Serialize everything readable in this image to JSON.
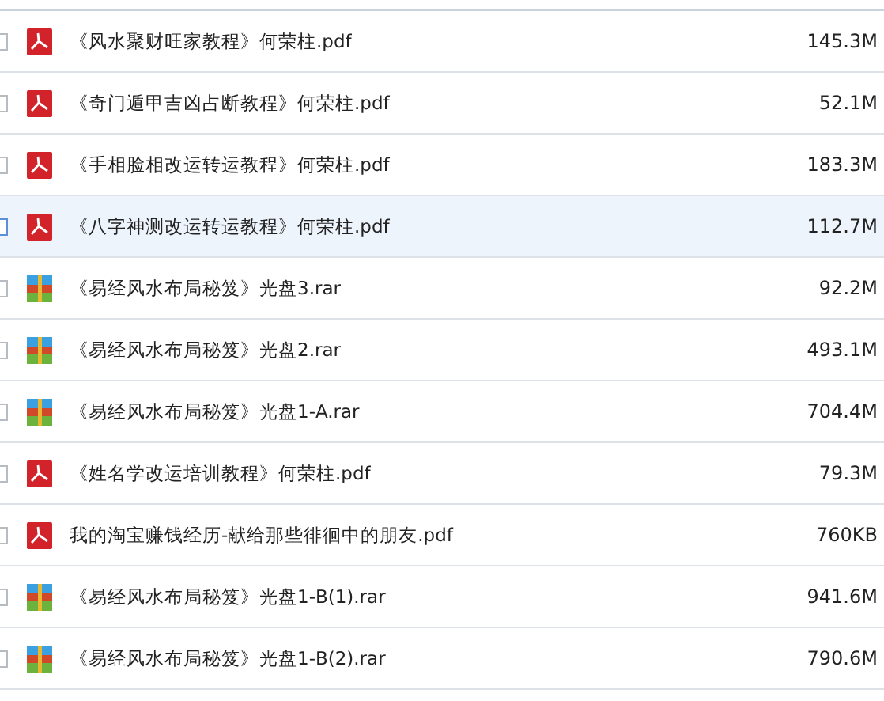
{
  "files": [
    {
      "kind": "pdf",
      "name": "《风水聚财旺家教程》何荣柱.pdf",
      "size": "145.3M",
      "highlighted": false
    },
    {
      "kind": "pdf",
      "name": "《奇门遁甲吉凶占断教程》何荣柱.pdf",
      "size": "52.1M",
      "highlighted": false
    },
    {
      "kind": "pdf",
      "name": "《手相脸相改运转运教程》何荣柱.pdf",
      "size": "183.3M",
      "highlighted": false
    },
    {
      "kind": "pdf",
      "name": "《八字神测改运转运教程》何荣柱.pdf",
      "size": "112.7M",
      "highlighted": true
    },
    {
      "kind": "rar",
      "name": "《易经风水布局秘笈》光盘3.rar",
      "size": "92.2M",
      "highlighted": false
    },
    {
      "kind": "rar",
      "name": "《易经风水布局秘笈》光盘2.rar",
      "size": "493.1M",
      "highlighted": false
    },
    {
      "kind": "rar",
      "name": "《易经风水布局秘笈》光盘1-A.rar",
      "size": "704.4M",
      "highlighted": false
    },
    {
      "kind": "pdf",
      "name": "《姓名学改运培训教程》何荣柱.pdf",
      "size": "79.3M",
      "highlighted": false
    },
    {
      "kind": "pdf",
      "name": "我的淘宝赚钱经历-献给那些徘徊中的朋友.pdf",
      "size": "760KB",
      "highlighted": false
    },
    {
      "kind": "rar",
      "name": "《易经风水布局秘笈》光盘1-B(1).rar",
      "size": "941.6M",
      "highlighted": false
    },
    {
      "kind": "rar",
      "name": "《易经风水布局秘笈》光盘1-B(2).rar",
      "size": "790.6M",
      "highlighted": false
    }
  ]
}
